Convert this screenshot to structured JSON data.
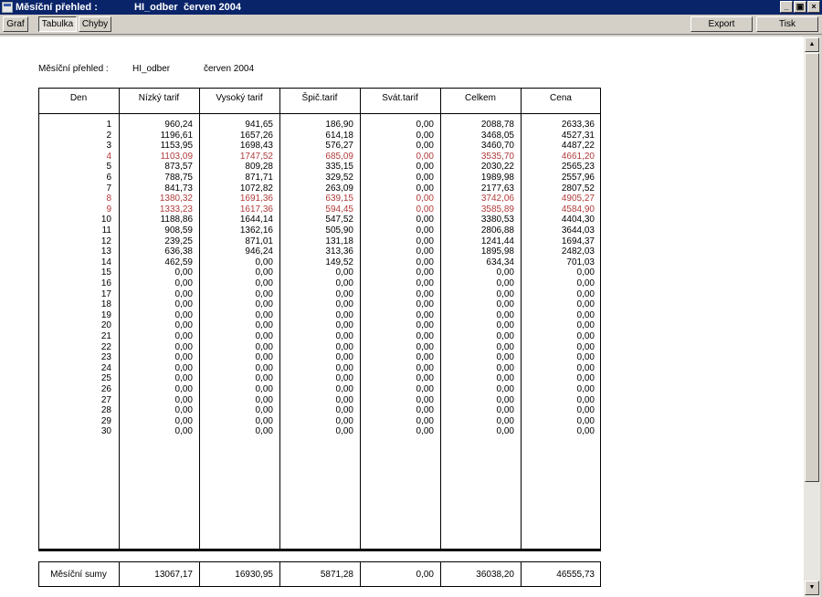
{
  "window": {
    "title_part1": "Měsíční přehled :",
    "title_part2": "HI_odber",
    "title_part3": "červen 2004",
    "buttons": {
      "minimize": "_",
      "restore": "▣",
      "close": "×"
    }
  },
  "toolbar": {
    "graf": "Graf",
    "tabulka": "Tabulka",
    "chyby": "Chyby",
    "export": "Export",
    "tisk": "Tisk"
  },
  "report": {
    "label": "Měsíční přehled :",
    "object": "HI_odber",
    "period": "červen 2004"
  },
  "table": {
    "columns": [
      "Den",
      "Nízký tarif",
      "Vysoký tarif",
      "Špič.tarif",
      "Svát.tarif",
      "Celkem",
      "Cena"
    ],
    "rows": [
      {
        "den": "1",
        "nt": "960,24",
        "vt": "941,65",
        "st": "186,90",
        "sv": "0,00",
        "ce": "2088,78",
        "cn": "2633,36",
        "hl": false
      },
      {
        "den": "2",
        "nt": "1196,61",
        "vt": "1657,26",
        "st": "614,18",
        "sv": "0,00",
        "ce": "3468,05",
        "cn": "4527,31",
        "hl": false
      },
      {
        "den": "3",
        "nt": "1153,95",
        "vt": "1698,43",
        "st": "576,27",
        "sv": "0,00",
        "ce": "3460,70",
        "cn": "4487,22",
        "hl": false
      },
      {
        "den": "4",
        "nt": "1103,09",
        "vt": "1747,52",
        "st": "685,09",
        "sv": "0,00",
        "ce": "3535,70",
        "cn": "4661,20",
        "hl": true
      },
      {
        "den": "5",
        "nt": "873,57",
        "vt": "809,28",
        "st": "335,15",
        "sv": "0,00",
        "ce": "2030,22",
        "cn": "2565,23",
        "hl": false
      },
      {
        "den": "6",
        "nt": "788,75",
        "vt": "871,71",
        "st": "329,52",
        "sv": "0,00",
        "ce": "1989,98",
        "cn": "2557,96",
        "hl": false
      },
      {
        "den": "7",
        "nt": "841,73",
        "vt": "1072,82",
        "st": "263,09",
        "sv": "0,00",
        "ce": "2177,63",
        "cn": "2807,52",
        "hl": false
      },
      {
        "den": "8",
        "nt": "1380,32",
        "vt": "1691,36",
        "st": "639,15",
        "sv": "0,00",
        "ce": "3742,06",
        "cn": "4905,27",
        "hl": true
      },
      {
        "den": "9",
        "nt": "1333,23",
        "vt": "1617,36",
        "st": "594,45",
        "sv": "0,00",
        "ce": "3585,89",
        "cn": "4584,90",
        "hl": true
      },
      {
        "den": "10",
        "nt": "1188,86",
        "vt": "1644,14",
        "st": "547,52",
        "sv": "0,00",
        "ce": "3380,53",
        "cn": "4404,30",
        "hl": false
      },
      {
        "den": "11",
        "nt": "908,59",
        "vt": "1362,16",
        "st": "505,90",
        "sv": "0,00",
        "ce": "2806,88",
        "cn": "3644,03",
        "hl": false
      },
      {
        "den": "12",
        "nt": "239,25",
        "vt": "871,01",
        "st": "131,18",
        "sv": "0,00",
        "ce": "1241,44",
        "cn": "1694,37",
        "hl": false
      },
      {
        "den": "13",
        "nt": "636,38",
        "vt": "946,24",
        "st": "313,36",
        "sv": "0,00",
        "ce": "1895,98",
        "cn": "2482,03",
        "hl": false
      },
      {
        "den": "14",
        "nt": "462,59",
        "vt": "0,00",
        "st": "149,52",
        "sv": "0,00",
        "ce": "634,34",
        "cn": "701,03",
        "hl": false
      },
      {
        "den": "15",
        "nt": "0,00",
        "vt": "0,00",
        "st": "0,00",
        "sv": "0,00",
        "ce": "0,00",
        "cn": "0,00",
        "hl": false
      },
      {
        "den": "16",
        "nt": "0,00",
        "vt": "0,00",
        "st": "0,00",
        "sv": "0,00",
        "ce": "0,00",
        "cn": "0,00",
        "hl": false
      },
      {
        "den": "17",
        "nt": "0,00",
        "vt": "0,00",
        "st": "0,00",
        "sv": "0,00",
        "ce": "0,00",
        "cn": "0,00",
        "hl": false
      },
      {
        "den": "18",
        "nt": "0,00",
        "vt": "0,00",
        "st": "0,00",
        "sv": "0,00",
        "ce": "0,00",
        "cn": "0,00",
        "hl": false
      },
      {
        "den": "19",
        "nt": "0,00",
        "vt": "0,00",
        "st": "0,00",
        "sv": "0,00",
        "ce": "0,00",
        "cn": "0,00",
        "hl": false
      },
      {
        "den": "20",
        "nt": "0,00",
        "vt": "0,00",
        "st": "0,00",
        "sv": "0,00",
        "ce": "0,00",
        "cn": "0,00",
        "hl": false
      },
      {
        "den": "21",
        "nt": "0,00",
        "vt": "0,00",
        "st": "0,00",
        "sv": "0,00",
        "ce": "0,00",
        "cn": "0,00",
        "hl": false
      },
      {
        "den": "22",
        "nt": "0,00",
        "vt": "0,00",
        "st": "0,00",
        "sv": "0,00",
        "ce": "0,00",
        "cn": "0,00",
        "hl": false
      },
      {
        "den": "23",
        "nt": "0,00",
        "vt": "0,00",
        "st": "0,00",
        "sv": "0,00",
        "ce": "0,00",
        "cn": "0,00",
        "hl": false
      },
      {
        "den": "24",
        "nt": "0,00",
        "vt": "0,00",
        "st": "0,00",
        "sv": "0,00",
        "ce": "0,00",
        "cn": "0,00",
        "hl": false
      },
      {
        "den": "25",
        "nt": "0,00",
        "vt": "0,00",
        "st": "0,00",
        "sv": "0,00",
        "ce": "0,00",
        "cn": "0,00",
        "hl": false
      },
      {
        "den": "26",
        "nt": "0,00",
        "vt": "0,00",
        "st": "0,00",
        "sv": "0,00",
        "ce": "0,00",
        "cn": "0,00",
        "hl": false
      },
      {
        "den": "27",
        "nt": "0,00",
        "vt": "0,00",
        "st": "0,00",
        "sv": "0,00",
        "ce": "0,00",
        "cn": "0,00",
        "hl": false
      },
      {
        "den": "28",
        "nt": "0,00",
        "vt": "0,00",
        "st": "0,00",
        "sv": "0,00",
        "ce": "0,00",
        "cn": "0,00",
        "hl": false
      },
      {
        "den": "29",
        "nt": "0,00",
        "vt": "0,00",
        "st": "0,00",
        "sv": "0,00",
        "ce": "0,00",
        "cn": "0,00",
        "hl": false
      },
      {
        "den": "30",
        "nt": "0,00",
        "vt": "0,00",
        "st": "0,00",
        "sv": "0,00",
        "ce": "0,00",
        "cn": "0,00",
        "hl": false
      }
    ],
    "sums": {
      "label": "Měsíční sumy",
      "nt": "13067,17",
      "vt": "16930,95",
      "st": "5871,28",
      "sv": "0,00",
      "ce": "36038,20",
      "cn": "46555,73"
    }
  },
  "colors": {
    "titlebar": "#0a246a",
    "highlight_row": "#b03a3a"
  }
}
